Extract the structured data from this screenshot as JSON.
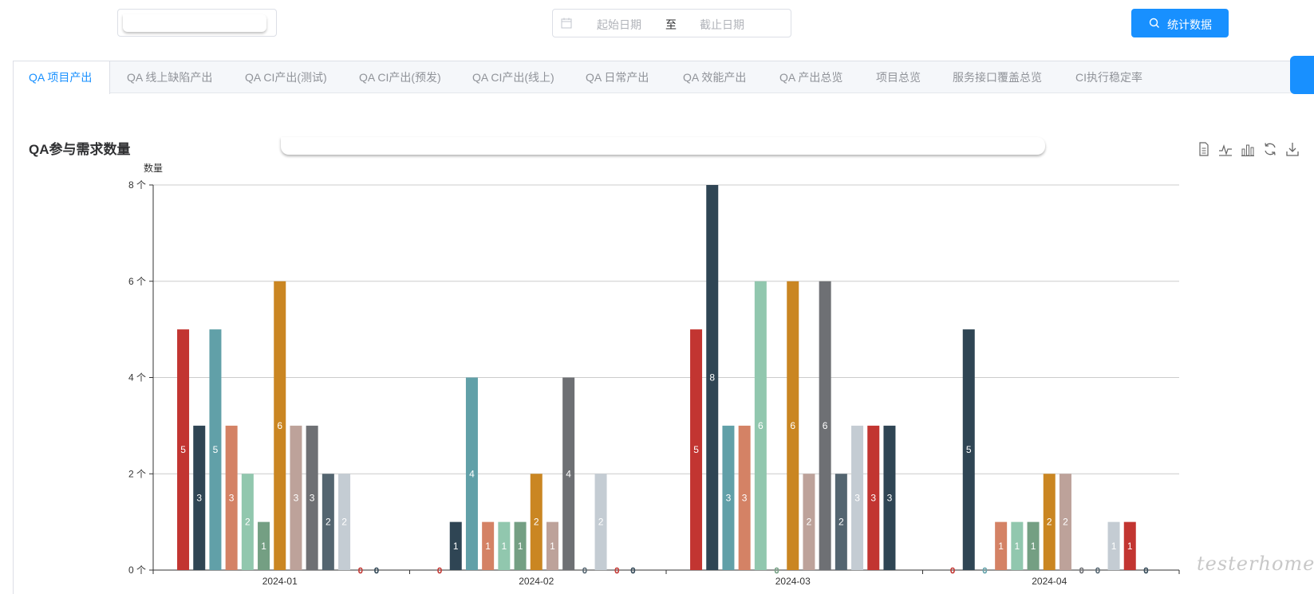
{
  "filters": {
    "date_start_placeholder": "起始日期",
    "date_separator": "至",
    "date_end_placeholder": "截止日期",
    "stat_button": "统计数据"
  },
  "tabs": [
    {
      "label": "QA 项目产出",
      "active": true
    },
    {
      "label": "QA 线上缺陷产出",
      "active": false
    },
    {
      "label": "QA CI产出(测试)",
      "active": false
    },
    {
      "label": "QA CI产出(预发)",
      "active": false
    },
    {
      "label": "QA CI产出(线上)",
      "active": false
    },
    {
      "label": "QA 日常产出",
      "active": false
    },
    {
      "label": "QA 效能产出",
      "active": false
    },
    {
      "label": "QA 产出总览",
      "active": false
    },
    {
      "label": "项目总览",
      "active": false
    },
    {
      "label": "服务接口覆盖总览",
      "active": false
    },
    {
      "label": "CI执行稳定率",
      "active": false
    }
  ],
  "toolbox": [
    "data-view-icon",
    "line-chart-icon",
    "bar-chart-icon",
    "restore-icon",
    "download-icon"
  ],
  "watermark": "testerhome.com",
  "colors": {
    "accent": "#1890ff",
    "palette": [
      "#c23531",
      "#2f4554",
      "#61a0a8",
      "#d48265",
      "#91c7ae",
      "#749f83",
      "#ca8622",
      "#bda29a",
      "#6e7074",
      "#546570",
      "#c4ccd3"
    ]
  },
  "chart_data": {
    "type": "bar",
    "title": "QA参与需求数量",
    "ylabel": "数量",
    "y_tick_suffix": " 个",
    "ylim": [
      0,
      8
    ],
    "yticks": [
      0,
      2,
      4,
      6,
      8
    ],
    "grid": true,
    "categories": [
      "2024-01",
      "2024-02",
      "2024-03",
      "2024-04"
    ],
    "series": [
      {
        "color": "#c23531",
        "values": [
          5,
          0,
          5,
          0
        ]
      },
      {
        "color": "#2f4554",
        "values": [
          3,
          1,
          8,
          5
        ]
      },
      {
        "color": "#61a0a8",
        "values": [
          5,
          4,
          3,
          0
        ]
      },
      {
        "color": "#d48265",
        "values": [
          3,
          1,
          3,
          1
        ]
      },
      {
        "color": "#91c7ae",
        "values": [
          2,
          1,
          6,
          1
        ]
      },
      {
        "color": "#749f83",
        "values": [
          1,
          1,
          0,
          1
        ]
      },
      {
        "color": "#ca8622",
        "values": [
          6,
          2,
          6,
          2
        ]
      },
      {
        "color": "#bda29a",
        "values": [
          3,
          1,
          2,
          2
        ]
      },
      {
        "color": "#6e7074",
        "values": [
          3,
          4,
          6,
          0
        ]
      },
      {
        "color": "#546570",
        "values": [
          2,
          0,
          2,
          0
        ]
      },
      {
        "color": "#c4ccd3",
        "values": [
          2,
          2,
          3,
          1
        ]
      },
      {
        "color": "#c23531",
        "values": [
          0,
          0,
          3,
          1
        ]
      },
      {
        "color": "#2f4554",
        "values": [
          0,
          0,
          3,
          0
        ]
      }
    ]
  }
}
